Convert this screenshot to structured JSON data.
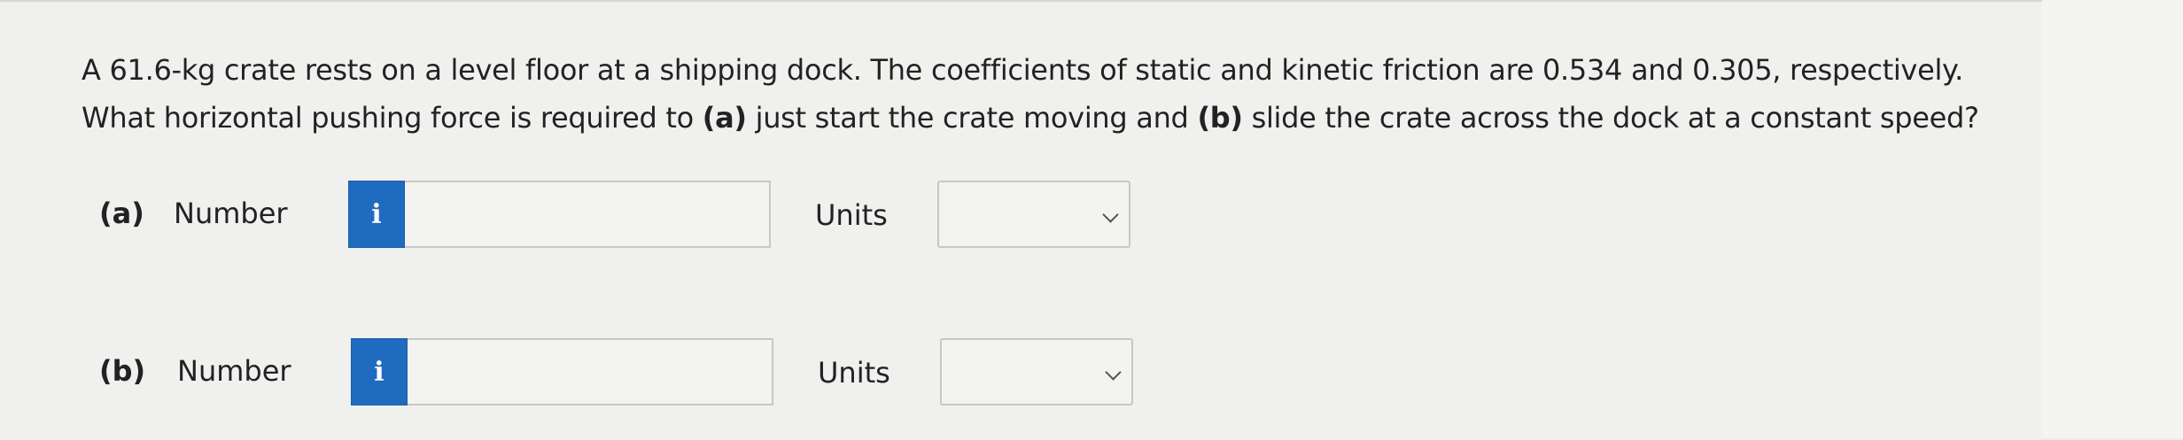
{
  "question": {
    "line1": "A 61.6-kg crate rests on a level floor at a shipping dock. The coefficients of static and kinetic friction are 0.534 and 0.305, respectively.",
    "line2_pre": "What horizontal pushing force is required to ",
    "part_a_marker": "(a)",
    "line2_mid": " just start the crate moving and ",
    "part_b_marker": "(b)",
    "line2_post": " slide the crate across the dock at a constant speed?"
  },
  "parts": [
    {
      "label": "(a)",
      "number_label": "Number",
      "info_icon": "i",
      "number_value": "",
      "units_label": "Units",
      "units_value": ""
    },
    {
      "label": "(b)",
      "number_label": "Number",
      "info_icon": "i",
      "number_value": "",
      "units_label": "Units",
      "units_value": ""
    }
  ],
  "colors": {
    "info_button": "#1f6bbf",
    "background": "#f0f0ee"
  }
}
